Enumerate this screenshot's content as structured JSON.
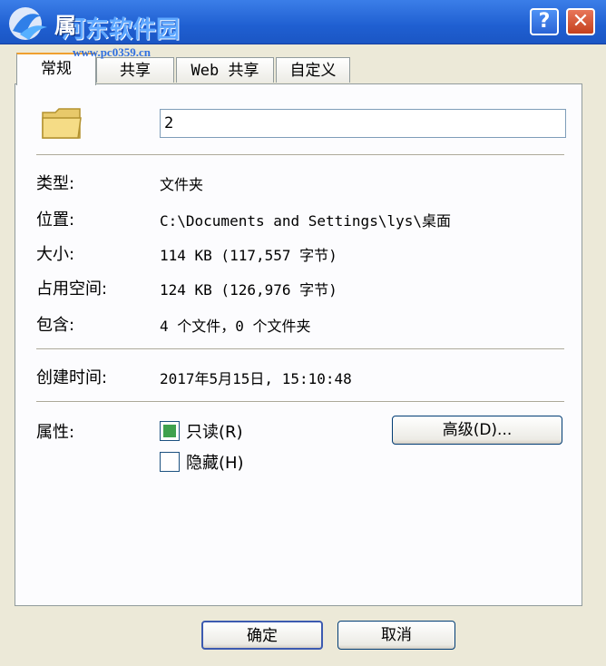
{
  "window": {
    "title_fragment": "属"
  },
  "watermark": {
    "text": "河东软件园",
    "url": "www.pc0359.cn"
  },
  "titlebar": {
    "help_label": "?",
    "close_label": "✕"
  },
  "tabs": [
    {
      "label": "常规",
      "active": true
    },
    {
      "label": "共享",
      "active": false
    },
    {
      "label": "Web 共享",
      "active": false
    },
    {
      "label": "自定义",
      "active": false
    }
  ],
  "general": {
    "icon": "folder-icon",
    "name_value": "2",
    "rows": [
      {
        "label": "类型:",
        "value": "文件夹"
      },
      {
        "label": "位置:",
        "value": "C:\\Documents and Settings\\lys\\桌面"
      },
      {
        "label": "大小:",
        "value": "114 KB (117,557 字节)"
      },
      {
        "label": "占用空间:",
        "value": "124 KB (126,976 字节)"
      },
      {
        "label": "包含:",
        "value": "4 个文件，0 个文件夹"
      }
    ],
    "created_label": "创建时间:",
    "created_value": "2017年5月15日, 15:10:48",
    "attributes_label": "属性:",
    "readonly_label": "只读(R)",
    "readonly_checked": true,
    "hidden_label": "隐藏(H)",
    "hidden_checked": false,
    "advanced_label": "高级(D)..."
  },
  "footer": {
    "ok_label": "确定",
    "cancel_label": "取消"
  },
  "colors": {
    "titlebar": "#1f5fd1",
    "dialog_bg": "#ece9d8",
    "panel_bg": "#fcfcfe",
    "checkbox_fill": "#3fa14d",
    "active_tab_accent": "#f0a030"
  }
}
